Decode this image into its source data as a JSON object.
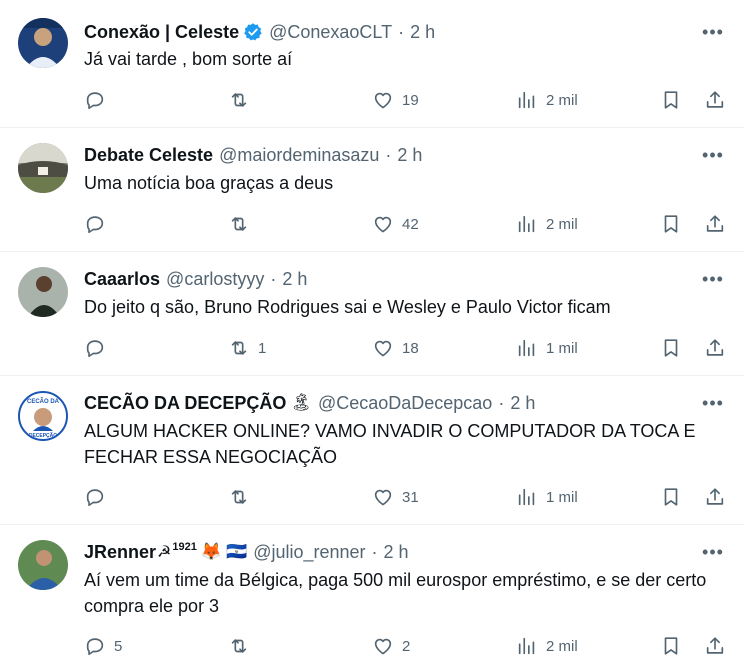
{
  "tweets": [
    {
      "name": "Conexão | Celeste",
      "verified": true,
      "emojis": [],
      "handle": "@ConexaoCLT",
      "time": "2 h",
      "text": "Já vai tarde , bom sorte aí",
      "replies": "",
      "retweets": "",
      "likes": "19",
      "views": "2 mil",
      "avatar_color": "#1d3f7a"
    },
    {
      "name": "Debate Celeste",
      "verified": false,
      "emojis": [],
      "handle": "@maiordeminasazu",
      "time": "2 h",
      "text": "Uma notícia boa graças a deus",
      "replies": "",
      "retweets": "",
      "likes": "42",
      "views": "2 mil",
      "avatar_color": "#6b6a5e"
    },
    {
      "name": "Caaarlos",
      "verified": false,
      "emojis": [],
      "handle": "@carlostyyy",
      "time": "2 h",
      "text": "Do jeito q são, Bruno Rodrigues sai e Wesley e Paulo Victor ficam",
      "replies": "",
      "retweets": "1",
      "likes": "18",
      "views": "1 mil",
      "avatar_color": "#2f3a33"
    },
    {
      "name": "CECÃO DA DECEPÇÃO",
      "verified": false,
      "emojis": [
        "🏝"
      ],
      "handle": "@CecaoDaDecepcao",
      "time": "2 h",
      "text": "ALGUM HACKER ONLINE? VAMO INVADIR O COMPUTADOR DA TOCA E FECHAR ESSA NEGOCIAÇÃO",
      "replies": "",
      "retweets": "",
      "likes": "31",
      "views": "1 mil",
      "avatar_color": "#1a56b3",
      "avatar_text_top": "CECÃO DA",
      "avatar_text_bottom": "DECEPÇÃO"
    },
    {
      "name": "JRenner",
      "verified": false,
      "emojis": [
        "☭",
        "1921",
        "🦊",
        "🇸🇻"
      ],
      "handle": "@julio_renner",
      "time": "2 h",
      "text": "Aí vem um time da Bélgica, paga 500 mil eurospor empréstimo, e se der certo compra ele por 3",
      "replies": "5",
      "retweets": "",
      "likes": "2",
      "views": "2 mil",
      "avatar_color": "#2b5fa8"
    }
  ],
  "icons": {
    "more": "more-icon",
    "reply": "reply-icon",
    "retweet": "retweet-icon",
    "like": "heart-icon",
    "views": "views-icon",
    "bookmark": "bookmark-icon",
    "share": "share-icon",
    "verified": "verified-badge-icon"
  },
  "colors": {
    "text": "#0f1419",
    "muted": "#536471",
    "verified": "#1d9bf0",
    "divider": "#eff3f4"
  }
}
